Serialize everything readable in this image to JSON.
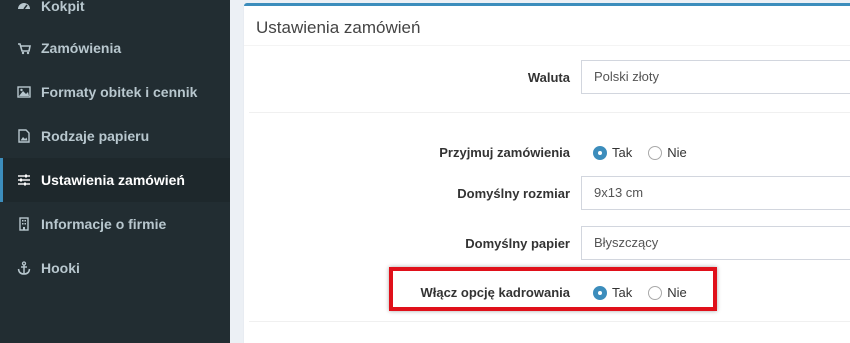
{
  "sidebar": {
    "items": [
      {
        "label": "Kokpit",
        "icon": "dashboard-icon"
      },
      {
        "label": "Zamówienia",
        "icon": "cart-icon"
      },
      {
        "label": "Formaty obitek i cennik",
        "icon": "image-icon"
      },
      {
        "label": "Rodzaje papieru",
        "icon": "file-image-icon"
      },
      {
        "label": "Ustawienia zamówień",
        "icon": "sliders-icon",
        "active": true
      },
      {
        "label": "Informacje o firmie",
        "icon": "building-icon"
      },
      {
        "label": "Hooki",
        "icon": "anchor-icon"
      }
    ]
  },
  "main": {
    "title": "Ustawienia zamówień",
    "fields": {
      "currency": {
        "label": "Waluta",
        "value": "Polski złoty"
      },
      "accept_orders": {
        "label": "Przyjmuj zamówienia",
        "yes": "Tak",
        "no": "Nie",
        "selected": "Tak"
      },
      "default_size": {
        "label": "Domyślny rozmiar",
        "value": "9x13 cm"
      },
      "default_paper": {
        "label": "Domyślny papier",
        "value": "Błyszczący"
      },
      "cropping": {
        "label": "Włącz opcję kadrowania",
        "yes": "Tak",
        "no": "Nie",
        "selected": "Tak"
      }
    }
  },
  "colors": {
    "sidebar_bg": "#222d32",
    "sidebar_active_bg": "#1e282c",
    "accent": "#3c8dbc",
    "highlight_border": "#e0101a"
  }
}
